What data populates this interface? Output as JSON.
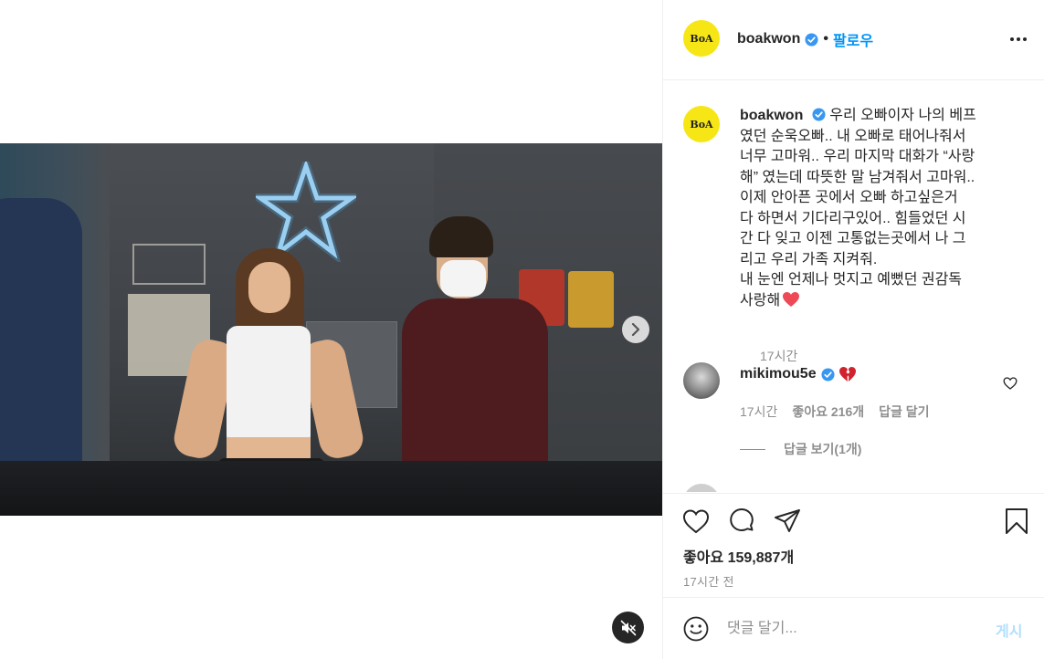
{
  "post": {
    "username": "boakwon",
    "avatar_text": "BoA",
    "follow_separator": "•",
    "follow_label": "팔로우",
    "caption_user": "boakwon",
    "caption_body": "우리 오빠이자 나의 베프\n였던 순욱오빠.. 내 오빠로 태어나줘서\n너무 고마워.. 우리 마지막 대화가 “사랑\n해” 였는데 따뜻한 말 남겨줘서 고마워..\n이제 안아픈 곳에서 오빠 하고싶은거\n다 하면서 기다리구있어.. 힘들었던 시\n간 다 잊고 이젠 고통없는곳에서 나 그\n리고 우리 가족 지켜줘.\n내 눈엔 언제나 멋지고 예뻤던 권감독\n사랑해",
    "caption_time": "17시간",
    "likes_text": "좋아요 159,887개",
    "timestamp": "17시간 전"
  },
  "comments": [
    {
      "username": "mikimou5e",
      "time": "17시간",
      "likes": "좋아요 216개",
      "reply_label": "답글 달기",
      "view_replies": "답글 보기(1개)"
    }
  ],
  "add_comment": {
    "placeholder": "댓글 달기...",
    "post_label": "게시"
  },
  "icons": {
    "verified": "verified-badge-icon",
    "heart_emoji": "red-heart-icon",
    "broken_heart": "broken-heart-icon",
    "like": "heart-outline-icon",
    "comment": "speech-bubble-icon",
    "share": "paper-plane-icon",
    "save": "bookmark-icon",
    "emoji": "smiley-icon",
    "more": "ellipsis-icon",
    "next": "chevron-right-icon",
    "mute": "speaker-muted-icon"
  },
  "colors": {
    "accent": "#0095f6",
    "verified": "#3897f0",
    "heart": "#ed4956",
    "muted_text": "#8e8e8e",
    "avatar_yellow": "#f7e616"
  }
}
